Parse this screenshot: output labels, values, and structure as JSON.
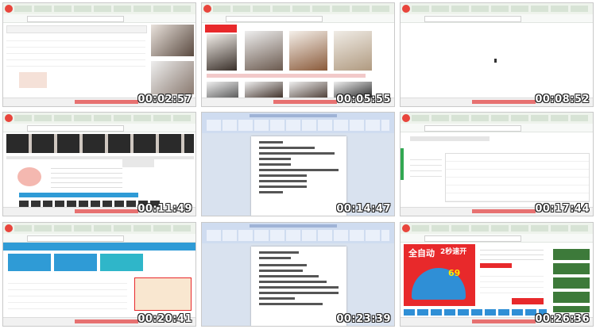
{
  "tiles": [
    {
      "timestamp": "00:02:57",
      "kind": "shop-filter"
    },
    {
      "timestamp": "00:05:55",
      "kind": "product-grid"
    },
    {
      "timestamp": "00:08:52",
      "kind": "blank-page"
    },
    {
      "timestamp": "00:11:49",
      "kind": "shop-page"
    },
    {
      "timestamp": "00:14:47",
      "kind": "word-document"
    },
    {
      "timestamp": "00:17:44",
      "kind": "dashboard"
    },
    {
      "timestamp": "00:20:41",
      "kind": "analytics"
    },
    {
      "timestamp": "00:23:39",
      "kind": "word-document"
    },
    {
      "timestamp": "00:26:36",
      "kind": "product-detail"
    }
  ],
  "colors": {
    "browser_logo": "#e8453c",
    "timestamp_text": "#ffffff",
    "accent_blue": "#2f9bd6",
    "promo_red": "#e8292b"
  },
  "icons": [
    "browser-logo-icon"
  ],
  "tile_d": {
    "promo_1": "全自动",
    "promo_2": "2秒速开",
    "price": "69"
  }
}
